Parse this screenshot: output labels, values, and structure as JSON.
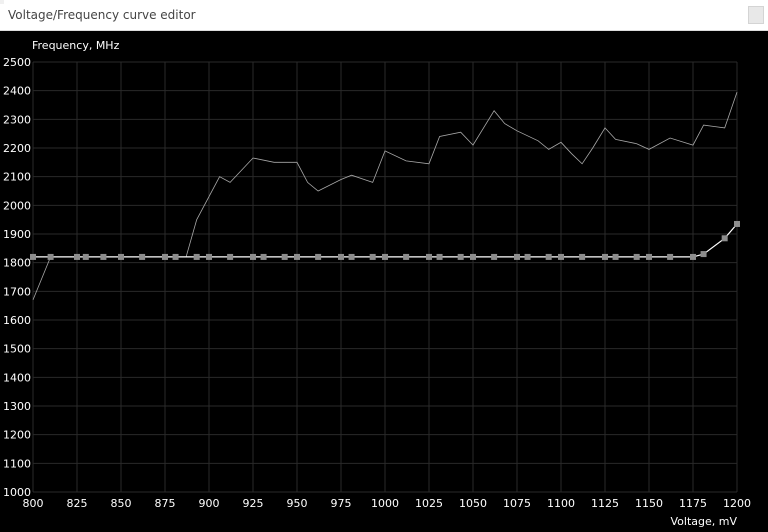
{
  "window": {
    "title": "Voltage/Frequency curve editor"
  },
  "colors": {
    "background": "#000000",
    "grid": "#2a2a2a",
    "curve": "#ffffff",
    "reference": "#a8a8a8",
    "point": "#8c8c8c"
  },
  "chart_data": {
    "type": "line",
    "xlabel": "Voltage, mV",
    "ylabel": "Frequency, MHz",
    "xlim": [
      800,
      1200
    ],
    "ylim": [
      1000,
      2500
    ],
    "x_ticks": [
      800,
      825,
      850,
      875,
      900,
      925,
      950,
      975,
      1000,
      1025,
      1050,
      1075,
      1100,
      1125,
      1150,
      1175,
      1200
    ],
    "y_ticks": [
      1000,
      1100,
      1200,
      1300,
      1400,
      1500,
      1600,
      1700,
      1800,
      1900,
      2000,
      2100,
      2200,
      2300,
      2400,
      2500
    ],
    "grid": true,
    "series": [
      {
        "style": "reference",
        "x": [
          800,
          810,
          825,
          850,
          875,
          887,
          893,
          906,
          912,
          925,
          937,
          950,
          956,
          962,
          975,
          981,
          993,
          1000,
          1012,
          1025,
          1031,
          1043,
          1050,
          1062,
          1068,
          1075,
          1087,
          1093,
          1100,
          1106,
          1112,
          1118,
          1125,
          1131,
          1143,
          1150,
          1162,
          1175,
          1181,
          1187,
          1193,
          1200
        ],
        "y": [
          1670,
          1820,
          1820,
          1820,
          1820,
          1820,
          1950,
          2100,
          2080,
          2165,
          2150,
          2150,
          2080,
          2050,
          2090,
          2105,
          2080,
          2190,
          2155,
          2145,
          2240,
          2255,
          2210,
          2330,
          2285,
          2260,
          2225,
          2195,
          2220,
          2180,
          2145,
          2200,
          2270,
          2230,
          2215,
          2195,
          2235,
          2210,
          2280,
          2275,
          2270,
          2395
        ]
      },
      {
        "style": "curve",
        "x": [
          800,
          810,
          825,
          830,
          840,
          850,
          862,
          875,
          881,
          893,
          900,
          912,
          925,
          931,
          943,
          950,
          962,
          975,
          981,
          993,
          1000,
          1012,
          1025,
          1031,
          1043,
          1050,
          1062,
          1075,
          1081,
          1093,
          1100,
          1112,
          1125,
          1131,
          1143,
          1150,
          1162,
          1175,
          1181,
          1193,
          1200
        ],
        "y": [
          1820,
          1820,
          1820,
          1820,
          1820,
          1820,
          1820,
          1820,
          1820,
          1820,
          1820,
          1820,
          1820,
          1820,
          1820,
          1820,
          1820,
          1820,
          1820,
          1820,
          1820,
          1820,
          1820,
          1820,
          1820,
          1820,
          1820,
          1820,
          1820,
          1820,
          1820,
          1820,
          1820,
          1820,
          1820,
          1820,
          1820,
          1820,
          1830,
          1885,
          1935
        ]
      }
    ]
  }
}
